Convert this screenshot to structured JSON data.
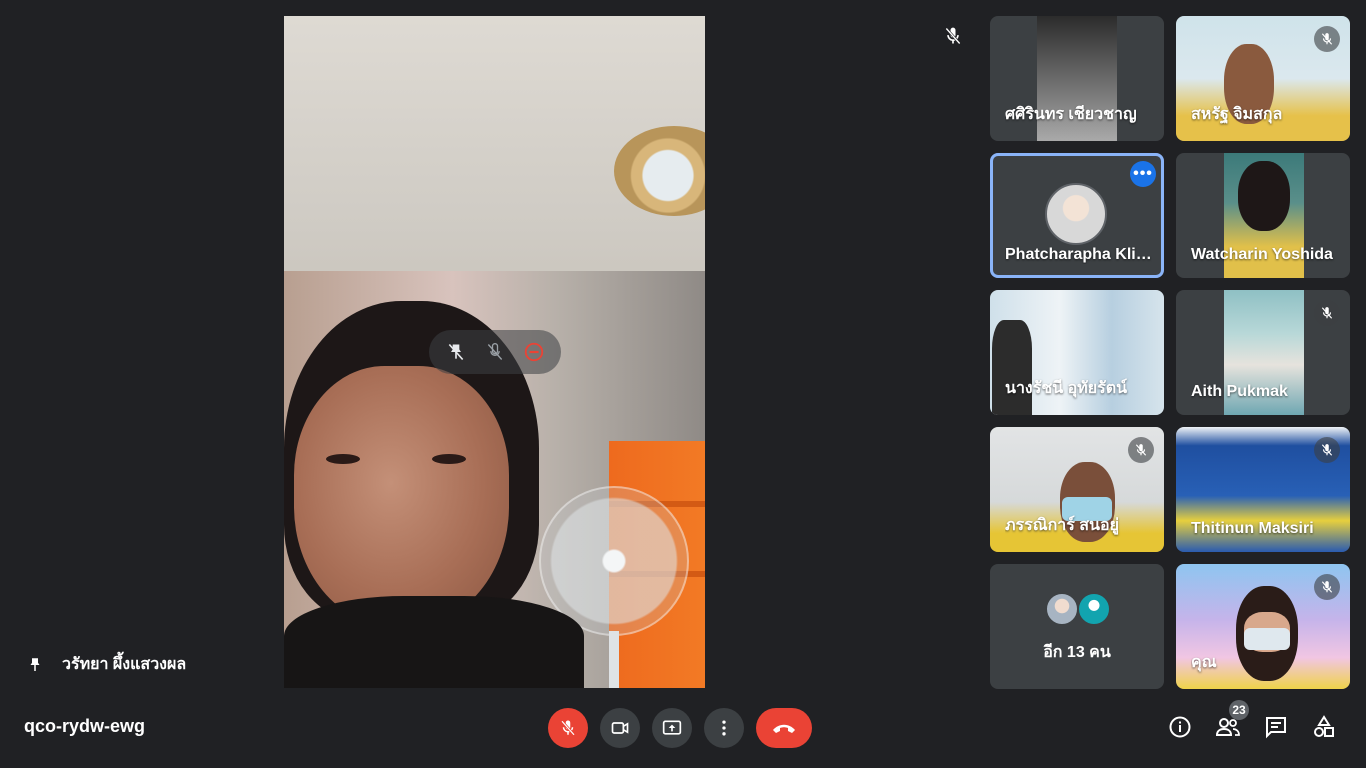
{
  "main": {
    "speaker_name": "วรัทยา ผึ้งแสวงผล",
    "overlay_icons": [
      "unpin-icon",
      "mic-off-icon",
      "remove-icon"
    ]
  },
  "tiles": [
    {
      "name": "ศศิรินทร เชียวชาญ",
      "muted": false
    },
    {
      "name": "สหรัฐ จิมสกุล",
      "muted": true
    },
    {
      "name": "Phatcharapha Klinsukhon",
      "muted": false,
      "selected": true
    },
    {
      "name": "Watcharin Yoshida",
      "muted": false
    },
    {
      "name": "นางรัชนี อุทัยรัตน์",
      "muted": false
    },
    {
      "name": "Aith Pukmak",
      "muted": true
    },
    {
      "name": "ภรรณิการ์ สนอยู่",
      "muted": true
    },
    {
      "name": "Thitinun Maksiri",
      "muted": true
    },
    {
      "name": "คุณ",
      "muted": true
    }
  ],
  "others": {
    "label": "อีก 13 คน"
  },
  "meeting": {
    "code": "qco-rydw-ewg",
    "participant_count": "23"
  },
  "controls": {
    "mic": "mic-off-icon",
    "camera": "camera-icon",
    "present": "present-icon",
    "more": "more-vert-icon",
    "hangup": "hangup-icon"
  },
  "colors": {
    "background": "#202124",
    "tile": "#3c4043",
    "danger": "#ea4335",
    "accent": "#1a73e8",
    "selected_outline": "#8ab4f8"
  }
}
